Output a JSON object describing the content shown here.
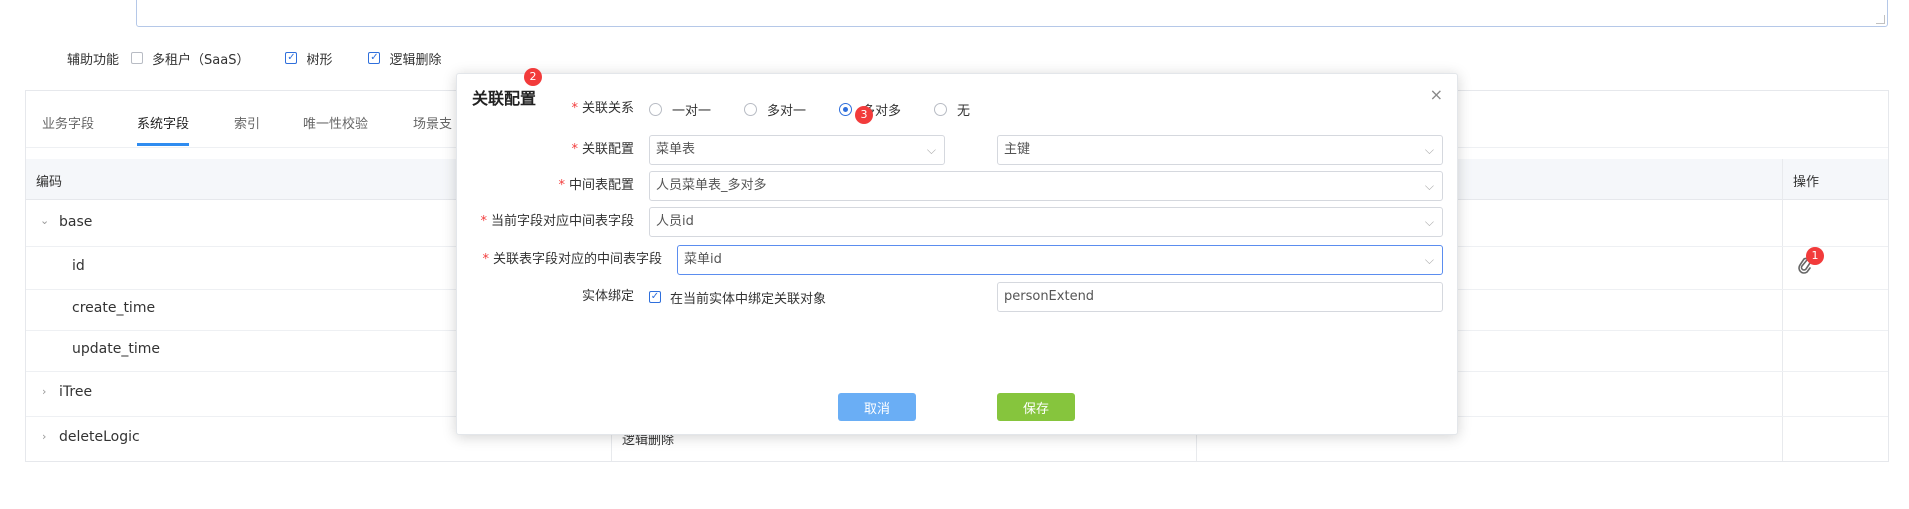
{
  "aux": {
    "label": "辅助功能",
    "options": [
      {
        "label": "多租户（SaaS）",
        "checked": false
      },
      {
        "label": "树形",
        "checked": true
      },
      {
        "label": "逻辑删除",
        "checked": true
      }
    ]
  },
  "tabs": [
    "业务字段",
    "系统字段",
    "索引",
    "唯一性校验",
    "场景支"
  ],
  "active_tab": "系统字段",
  "table": {
    "headers": {
      "code": "编码",
      "ops": "操作"
    },
    "rows": [
      {
        "code": "base",
        "expander": "⌄",
        "desc": ""
      },
      {
        "code": "id",
        "desc": ""
      },
      {
        "code": "create_time",
        "desc": ""
      },
      {
        "code": "update_time",
        "desc": ""
      },
      {
        "code": "iTree",
        "expander": "›",
        "desc": ""
      },
      {
        "code": "deleteLogic",
        "expander": "›",
        "desc": "逻辑删除"
      }
    ]
  },
  "badges": {
    "b1": "1",
    "b2": "2",
    "b3": "3"
  },
  "modal": {
    "title": "关联配置",
    "close": "×",
    "relation": {
      "label": "关联关系",
      "options": [
        {
          "label": "一对一",
          "selected": false
        },
        {
          "label": "多对一",
          "selected": false
        },
        {
          "label": "多对多",
          "selected": true
        },
        {
          "label": "无",
          "selected": false
        }
      ]
    },
    "config": {
      "label": "关联配置",
      "table_value": "菜单表",
      "key_value": "主键"
    },
    "middle": {
      "label": "中间表配置",
      "value": "人员菜单表_多对多"
    },
    "current_field": {
      "label": "当前字段对应中间表字段",
      "value": "人员id"
    },
    "related_field": {
      "label": "关联表字段对应的中间表字段",
      "value": "菜单id"
    },
    "entity": {
      "label": "实体绑定",
      "checkbox_label": "在当前实体中绑定关联对象",
      "value": "personExtend"
    },
    "cancel": "取消",
    "save": "保存",
    "required_mark": "*",
    "arrow": "⌵"
  }
}
